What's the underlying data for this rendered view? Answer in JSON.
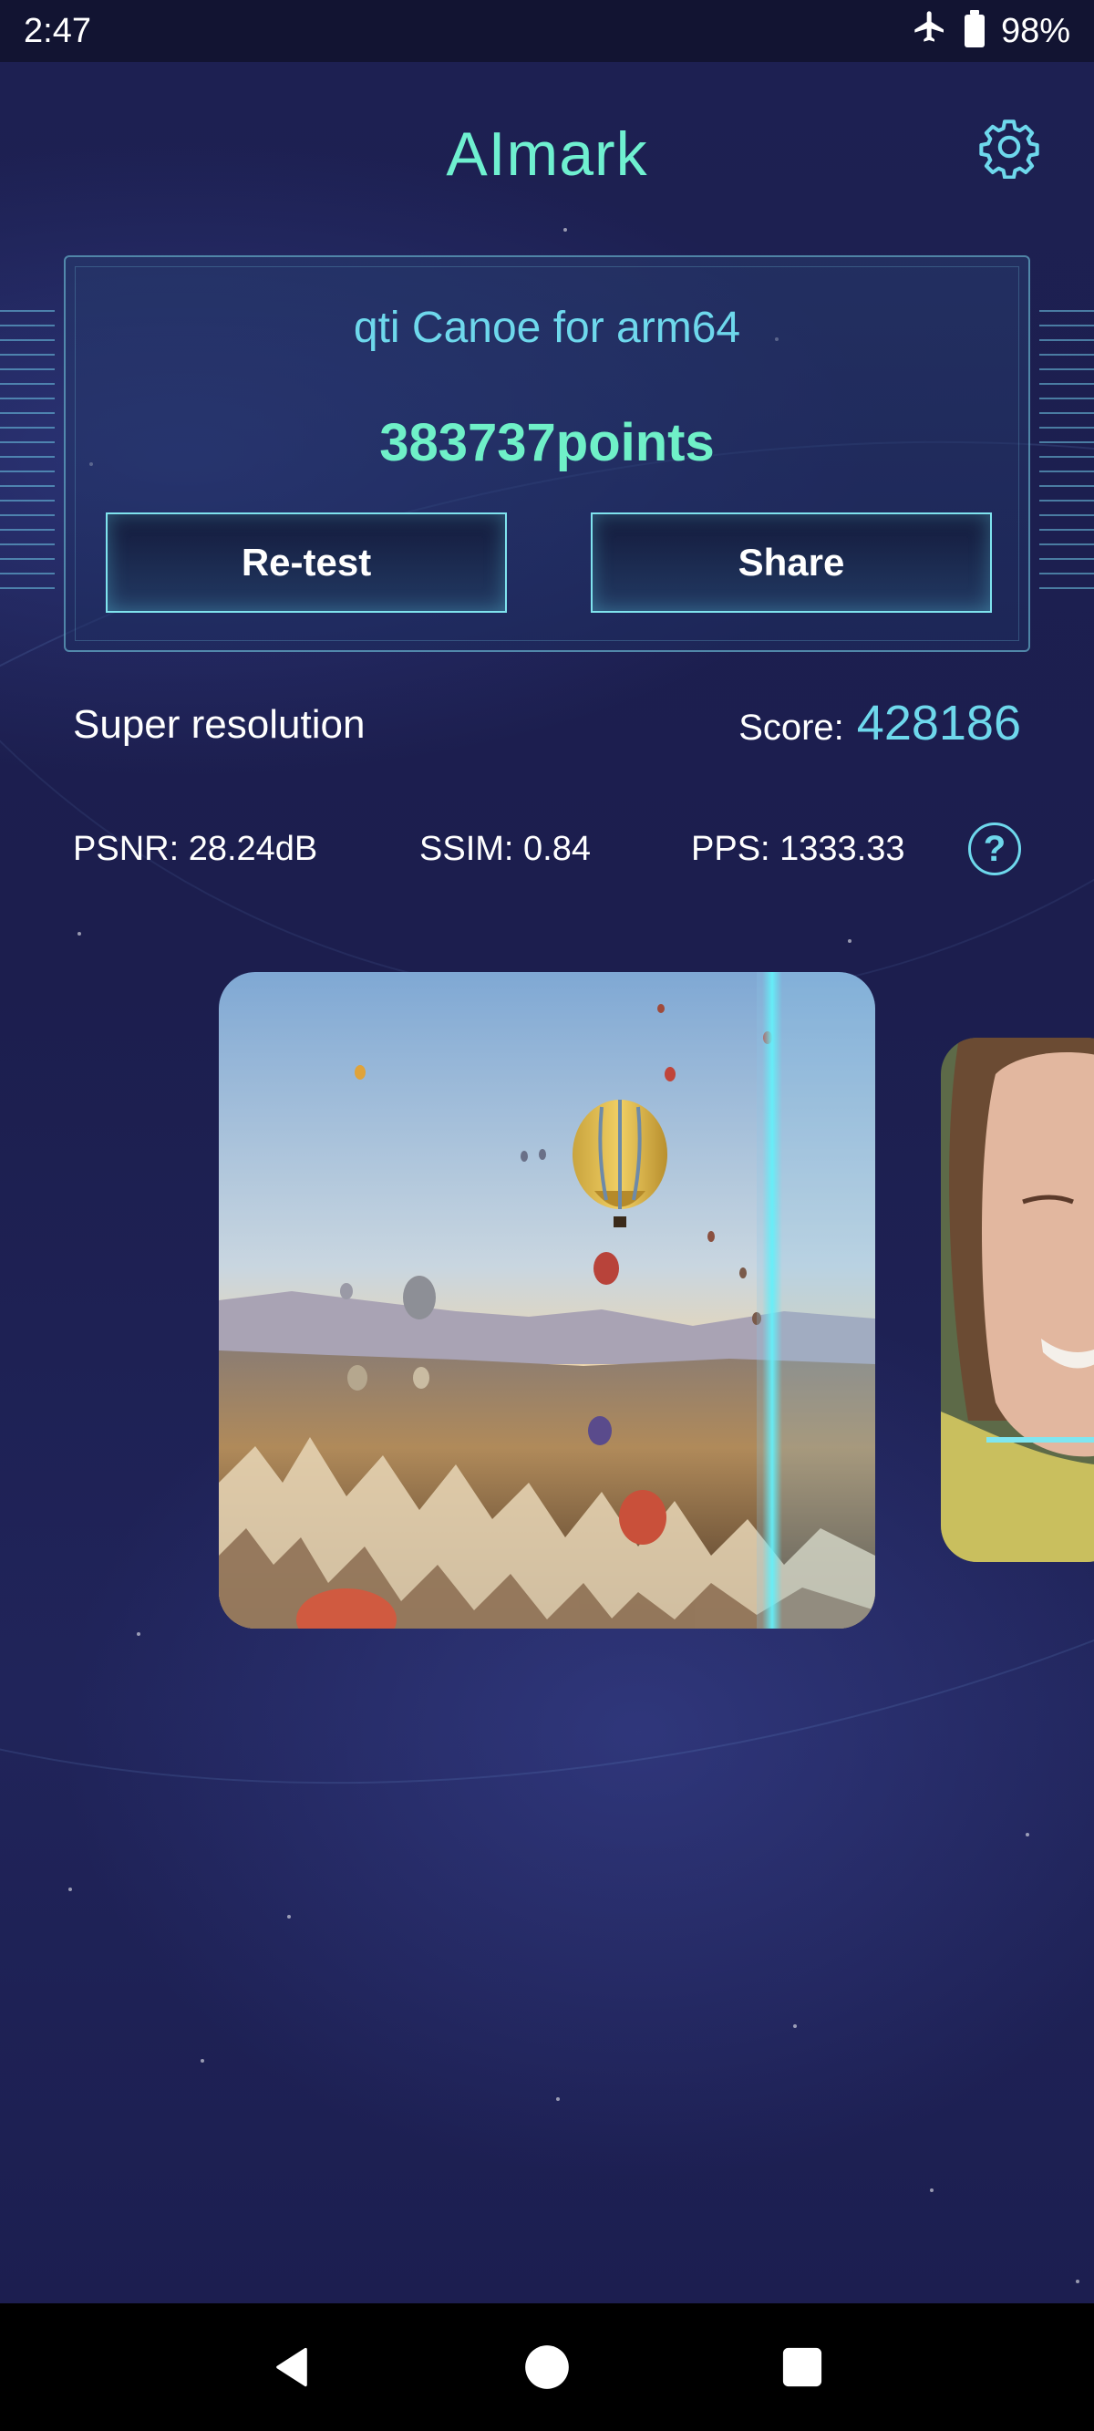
{
  "status_bar": {
    "time": "2:47",
    "battery": "98%",
    "icons": [
      "airplane-icon",
      "battery-icon"
    ]
  },
  "header": {
    "title": "AImark",
    "settings_icon": "gear-icon"
  },
  "device_card": {
    "device_name": "qti Canoe for arm64",
    "total_score": "383737points",
    "retest_label": "Re-test",
    "share_label": "Share"
  },
  "test": {
    "name": "Super resolution",
    "score_label": "Score:",
    "score_value": "428186",
    "metrics": {
      "psnr": "PSNR: 28.24dB",
      "ssim": "SSIM: 0.84",
      "pps": "PPS: 1333.33"
    },
    "help_label": "?"
  },
  "images": {
    "main": "hot-air-balloons-landscape-image",
    "side": "smiling-woman-portrait-image"
  },
  "nav_bar": {
    "icons": [
      "back-icon",
      "home-icon",
      "recents-icon"
    ]
  },
  "colors": {
    "accent_teal": "#6ff0c8",
    "accent_cyan": "#6ed8ec",
    "background": "#1b1d4e"
  }
}
